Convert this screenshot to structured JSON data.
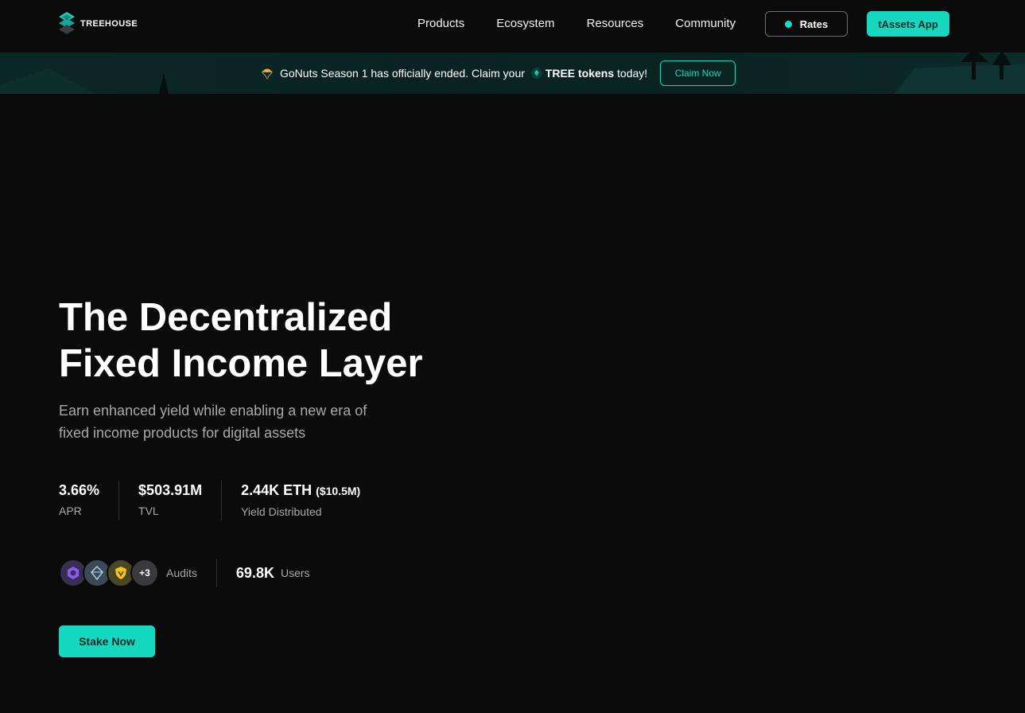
{
  "brand": {
    "name": "TREEHOUSE",
    "accent": "#16d7c0"
  },
  "nav": {
    "links": [
      "Products",
      "Ecosystem",
      "Resources",
      "Community"
    ],
    "rates_label": "Rates",
    "app_label": "tAssets App"
  },
  "banner": {
    "text_before": "GoNuts Season 1 has officially ended. Claim your",
    "token_text": "TREE tokens",
    "text_after": "today!",
    "claim_label": "Claim Now"
  },
  "hero": {
    "title_line1": "The Decentralized",
    "title_line2": "Fixed Income Layer",
    "subtitle_line1": "Earn enhanced yield while enabling a new era of",
    "subtitle_line2": "fixed income products for digital assets",
    "stats": [
      {
        "value": "3.66%",
        "extra": "",
        "label": "APR"
      },
      {
        "value": "$503.91M",
        "extra": "",
        "label": "TVL"
      },
      {
        "value": "2.44K ETH",
        "extra": "($10.5M)",
        "label": "Yield Distributed"
      }
    ],
    "audits": {
      "more": "+3",
      "label": "Audits"
    },
    "users": {
      "value": "69.8K",
      "label": "Users"
    },
    "cta_label": "Stake Now"
  }
}
